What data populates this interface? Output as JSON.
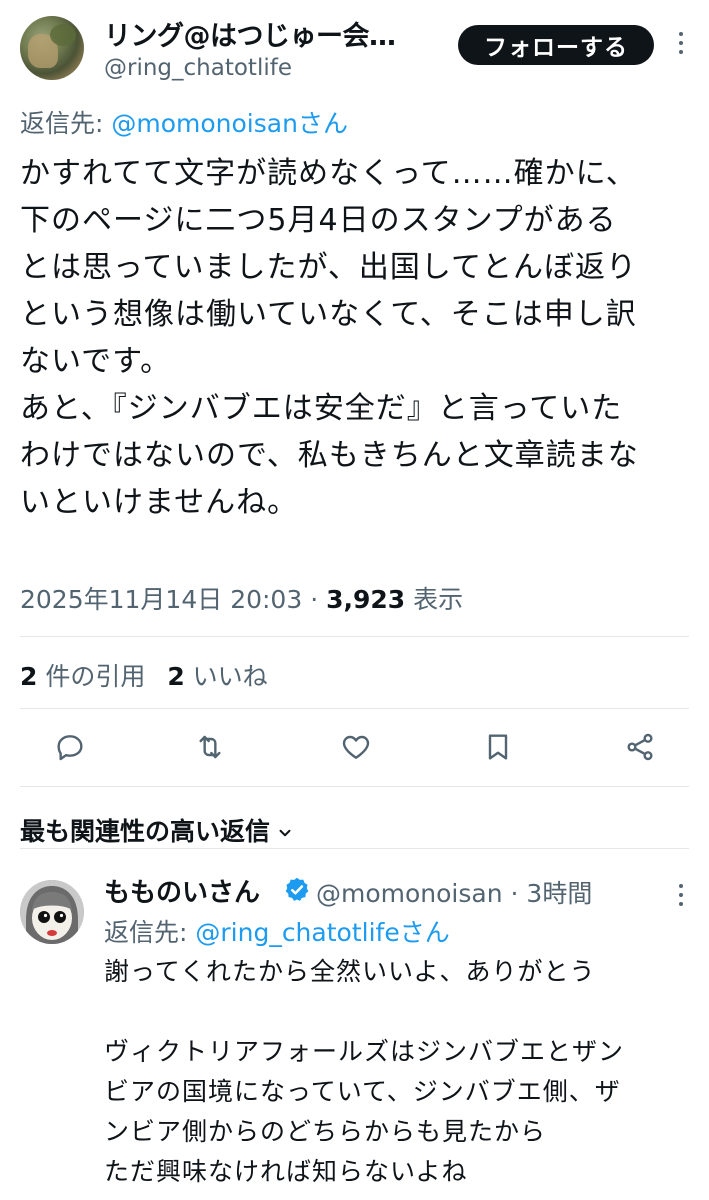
{
  "tweet": {
    "author": {
      "display_name": "リング@はつじゅー会…",
      "handle": "@ring_chatotlife"
    },
    "follow_label": "フォローする",
    "reply_to_prefix": "返信先: ",
    "reply_to_user": "@momonoisan",
    "reply_to_suffix": "さん",
    "body": "かすれてて文字が読めなくって……確かに、\n下のページに二つ5月4日のスタンプがある\nとは思っていましたが、出国してとんぼ返り\nという想像は働いていなくて、そこは申し訳\nないです。\nあと、『ジンバブエは安全だ』と言っていた\nわけではないので、私もきちんと文章読まな\nいといけませんね。",
    "timestamp": "2025年11月14日 20:03",
    "separator": " · ",
    "views_count": "3,923",
    "views_label": " 表示",
    "quotes_count": "2",
    "quotes_label": " 件の引用",
    "likes_count": "2",
    "likes_label": " いいね"
  },
  "actions": [
    "reply-icon",
    "retweet-icon",
    "like-icon",
    "bookmark-icon",
    "share-icon"
  ],
  "sort_label": "最も関連性の高い返信",
  "reply": {
    "display_name": "もものいさん",
    "handle": "@momonoisan",
    "time": " · 3時間",
    "reply_to_prefix": "返信先: ",
    "reply_to_user": "@ring_chatotlife",
    "reply_to_suffix": "さん",
    "body": "謝ってくれたから全然いいよ、ありがとう\n\nヴィクトリアフォールズはジンバブエとザン\nビアの国境になっていて、ジンバブエ側、ザ\nンビア側からのどちらからも見たから\nただ興味なければ知らないよね"
  },
  "colors": {
    "link": "#1d9bf0",
    "muted": "#536471",
    "text": "#0f1419",
    "verified": "#1d9bf0"
  }
}
